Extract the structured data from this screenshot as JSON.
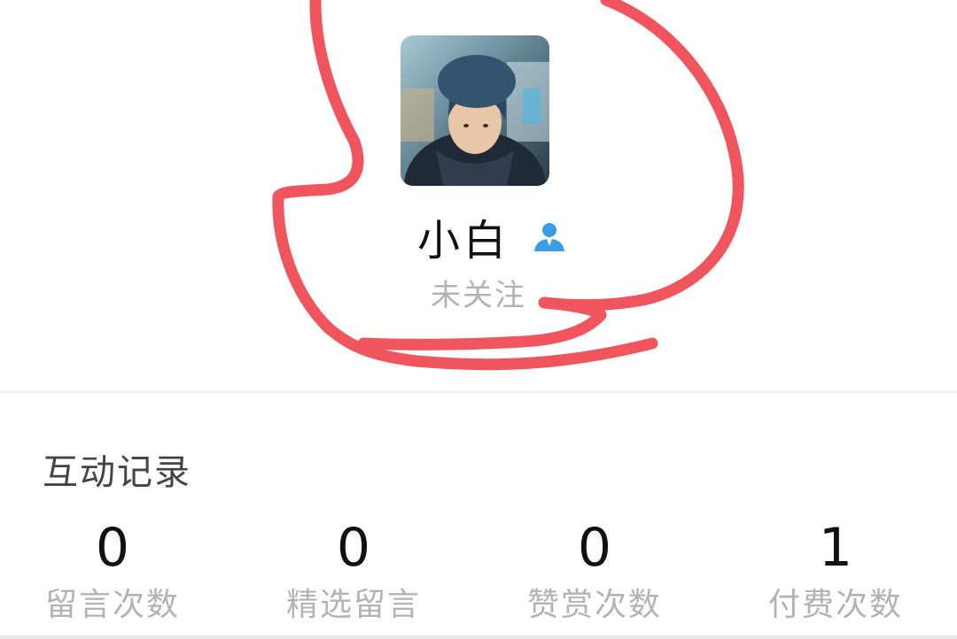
{
  "profile": {
    "name": "小白",
    "follow_status": "未关注",
    "avatar_icon": "avatar-photo",
    "user_icon": "user-icon",
    "user_icon_color": "#3a9ee6"
  },
  "interaction": {
    "title": "互动记录",
    "stats": [
      {
        "value": "0",
        "label": "留言次数"
      },
      {
        "value": "0",
        "label": "精选留言"
      },
      {
        "value": "0",
        "label": "赞赏次数"
      },
      {
        "value": "1",
        "label": "付费次数"
      }
    ]
  },
  "colors": {
    "annotation_red": "#f0555d",
    "muted_text": "#b3b3b3"
  }
}
